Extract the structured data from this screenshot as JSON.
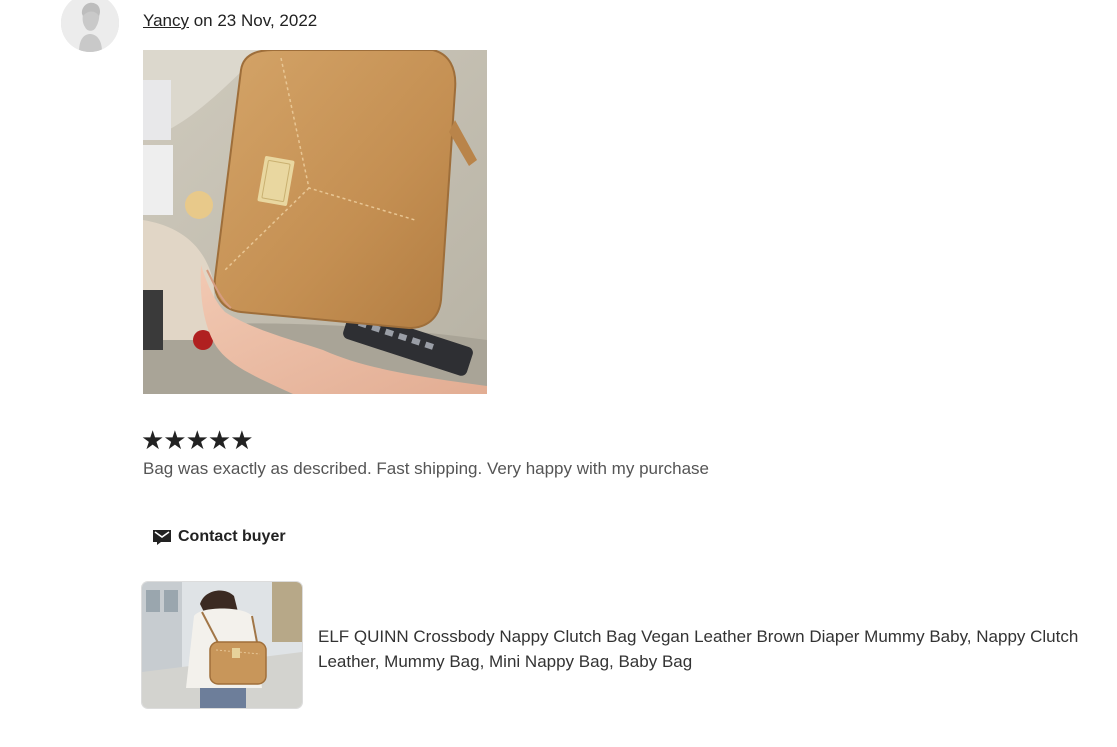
{
  "review": {
    "reviewer_name": "Yancy",
    "date_text": " on 23 Nov, 2022",
    "rating": 5,
    "stars": "★★★★★",
    "text": "Bag was exactly as described. Fast shipping. Very happy with my purchase"
  },
  "actions": {
    "contact_label": "Contact buyer"
  },
  "product": {
    "title": "ELF QUINN Crossbody Nappy Clutch Bag Vegan Leather Brown Diaper Mummy Baby, Nappy Clutch Leather, Mummy Bag, Mini Nappy Bag, Baby Bag"
  },
  "colors": {
    "bag_tan": "#c8965a",
    "text_dark": "#222222",
    "text_muted": "#555555"
  },
  "icons": {
    "avatar": "default-avatar-icon",
    "contact": "envelope-icon",
    "rating": "star-icon"
  }
}
